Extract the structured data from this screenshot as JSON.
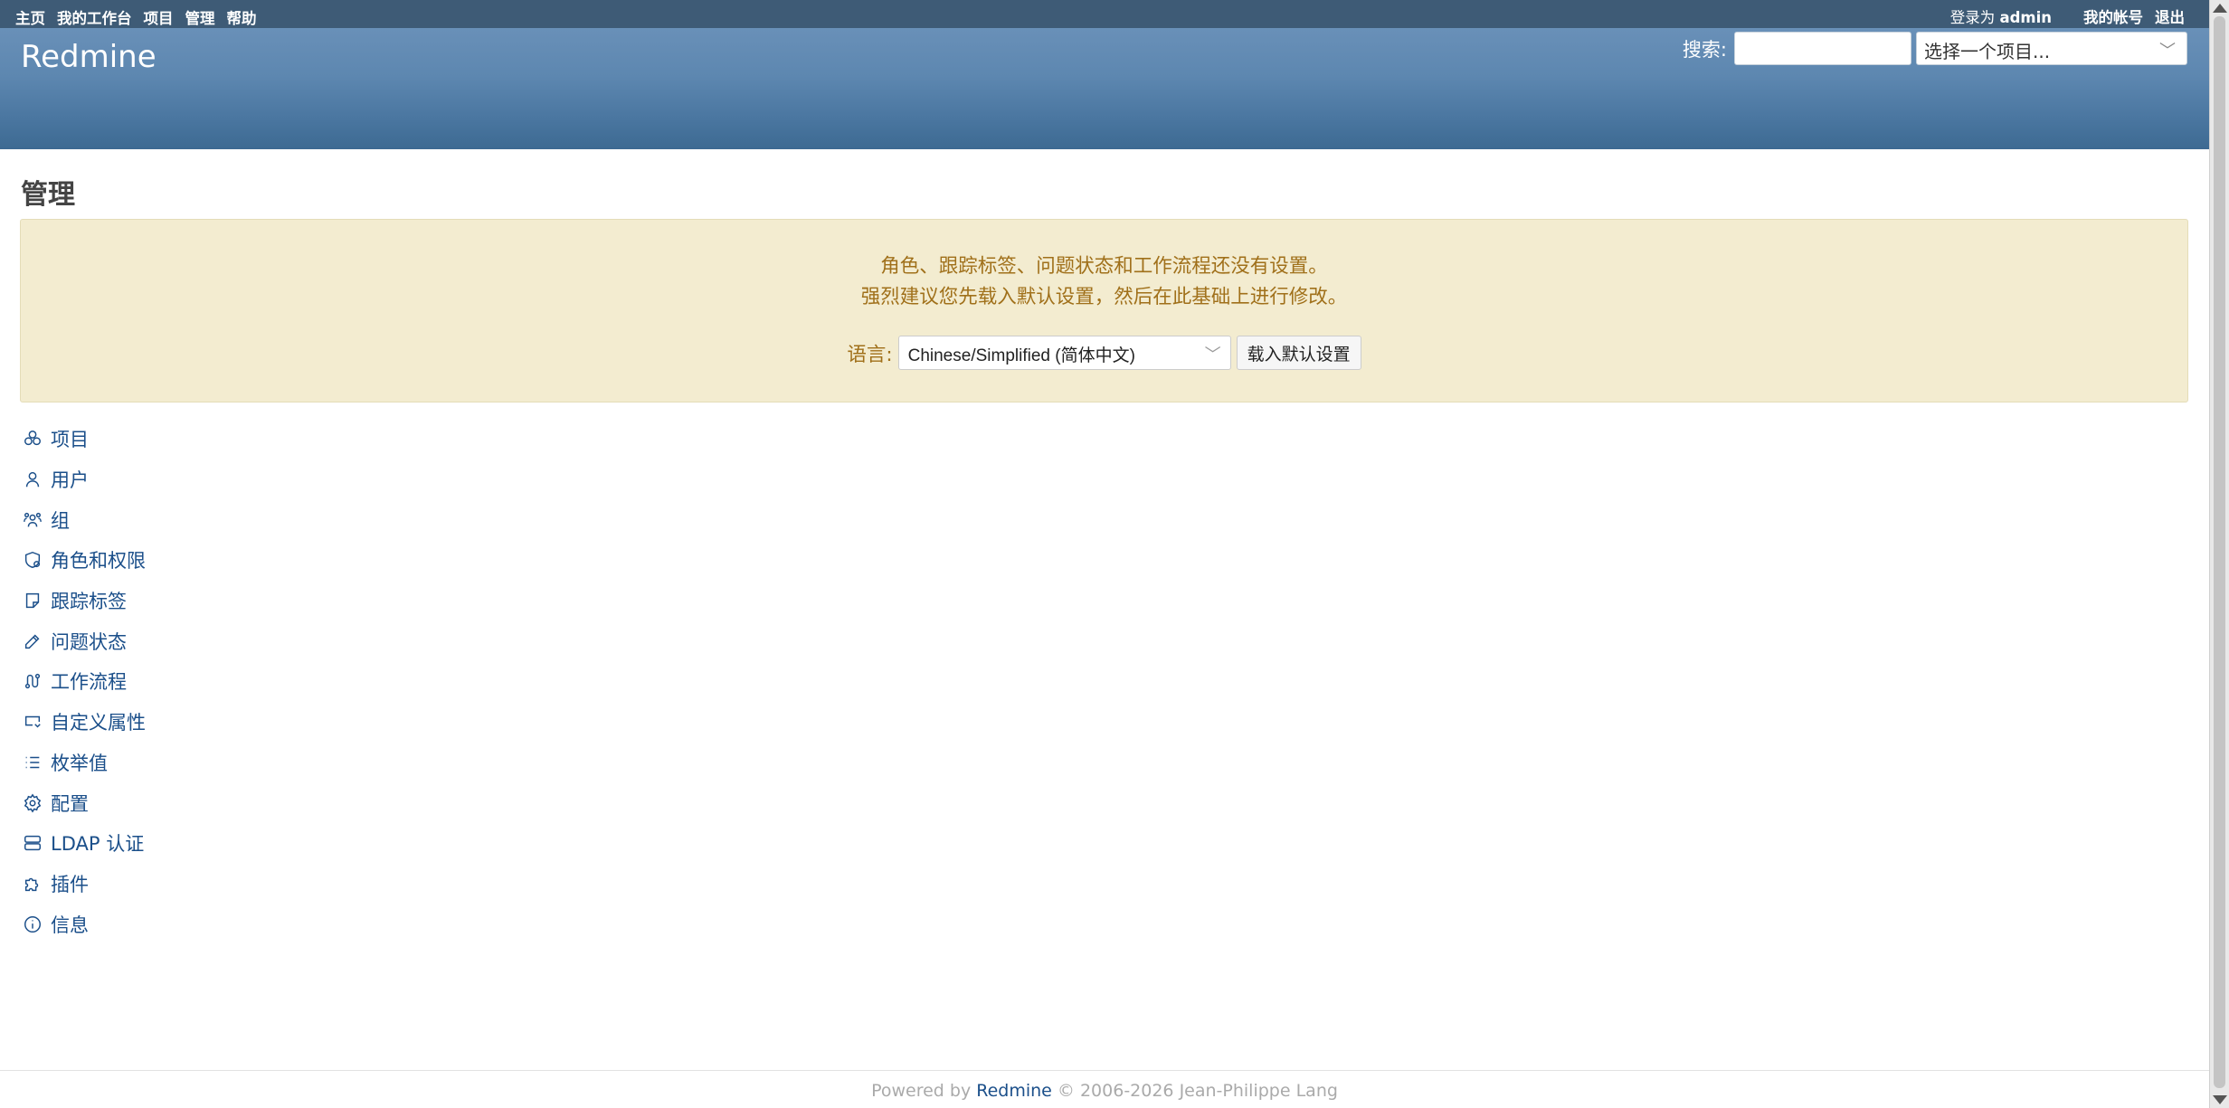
{
  "top_menu": {
    "items": [
      "主页",
      "我的工作台",
      "项目",
      "管理",
      "帮助"
    ],
    "logged_as_label": "登录为",
    "user": "admin",
    "my_account": "我的帐号",
    "logout": "退出"
  },
  "header": {
    "app_title": "Redmine",
    "search_label": "搜索:",
    "search_value": "",
    "project_jump_placeholder": "选择一个项目..."
  },
  "main": {
    "title": "管理",
    "notice": {
      "line1": "角色、跟踪标签、问题状态和工作流程还没有设置。",
      "line2": "强烈建议您先载入默认设置，然后在此基础上进行修改。",
      "language_label": "语言:",
      "language_value": "Chinese/Simplified (简体中文)",
      "load_button": "载入默认设置"
    },
    "admin_menu": [
      {
        "label": "项目",
        "icon": "projects-icon"
      },
      {
        "label": "用户",
        "icon": "user-icon"
      },
      {
        "label": "组",
        "icon": "group-icon"
      },
      {
        "label": "角色和权限",
        "icon": "shield-icon"
      },
      {
        "label": "跟踪标签",
        "icon": "tracker-icon"
      },
      {
        "label": "问题状态",
        "icon": "edit-icon"
      },
      {
        "label": "工作流程",
        "icon": "workflow-icon"
      },
      {
        "label": "自定义属性",
        "icon": "custom-fields-icon"
      },
      {
        "label": "枚举值",
        "icon": "list-icon"
      },
      {
        "label": "配置",
        "icon": "gear-icon"
      },
      {
        "label": "LDAP 认证",
        "icon": "server-icon"
      },
      {
        "label": "插件",
        "icon": "puzzle-icon"
      },
      {
        "label": "信息",
        "icon": "info-icon"
      }
    ]
  },
  "footer": {
    "powered_by": "Powered by",
    "link": "Redmine",
    "copyright": "© 2006-2026 Jean-Philippe Lang"
  }
}
